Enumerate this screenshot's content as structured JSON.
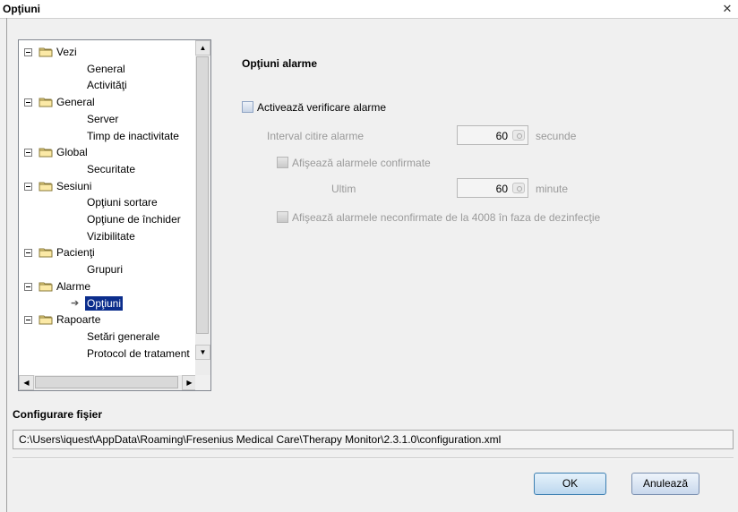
{
  "window": {
    "title": "Opţiuni",
    "close_glyph": "✕"
  },
  "tree": {
    "rows": [
      {
        "label": "Vezi",
        "type": "folder"
      },
      {
        "label": "General",
        "type": "leaf"
      },
      {
        "label": "Activităţi",
        "type": "leaf"
      },
      {
        "label": "General",
        "type": "folder"
      },
      {
        "label": "Server",
        "type": "leaf"
      },
      {
        "label": "Timp de inactivitate",
        "type": "leaf"
      },
      {
        "label": "Global",
        "type": "folder"
      },
      {
        "label": "Securitate",
        "type": "leaf"
      },
      {
        "label": "Sesiuni",
        "type": "folder"
      },
      {
        "label": "Opţiuni sortare",
        "type": "leaf"
      },
      {
        "label": "Opţiune de închider",
        "type": "leaf"
      },
      {
        "label": "Vizibilitate",
        "type": "leaf"
      },
      {
        "label": "Pacienţi",
        "type": "folder"
      },
      {
        "label": "Grupuri",
        "type": "leaf"
      },
      {
        "label": "Alarme",
        "type": "folder"
      },
      {
        "label": "Opţiuni",
        "type": "leaf",
        "selected": true
      },
      {
        "label": "Rapoarte",
        "type": "folder"
      },
      {
        "label": "Setări generale",
        "type": "leaf"
      },
      {
        "label": "Protocol de tratament",
        "type": "leaf",
        "partial": true
      }
    ]
  },
  "alarm_options": {
    "title": "Opţiuni alarme",
    "enable_check_label": "Activează verificare alarme",
    "interval_label": "Interval citire alarme",
    "interval_value": "60",
    "interval_unit": "secunde",
    "show_confirmed_label": "Afişează alarmele confirmate",
    "last_label": "Ultim",
    "last_value": "60",
    "last_unit": "minute",
    "show_unconfirmed_label": "Afişează alarmele neconfirmate de la 4008 în faza de dezinfecţie"
  },
  "config": {
    "title": "Configurare fişier",
    "path": "C:\\Users\\iquest\\AppData\\Roaming\\Fresenius Medical Care\\Therapy Monitor\\2.3.1.0\\configuration.xml"
  },
  "buttons": {
    "ok": "OK",
    "cancel": "Anulează"
  },
  "colors": {
    "selection": "#0b2d8c",
    "disabled_text": "#9a9a9a"
  }
}
